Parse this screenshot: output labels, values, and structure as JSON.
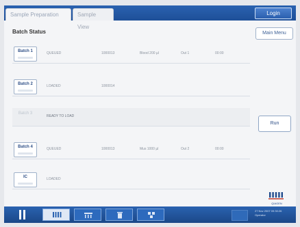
{
  "tabs": [
    {
      "label": "Sample Preparation"
    },
    {
      "label": "Sample View"
    }
  ],
  "login_label": "Login",
  "section_title": "Batch Status",
  "main_menu_label": "Main Menu",
  "batches": [
    {
      "label": "Batch 1",
      "status": "QUEUED",
      "id": "1000013",
      "volume": "Blood 200 µl",
      "output": "Out 1",
      "time": "00:00"
    },
    {
      "label": "Batch 2",
      "status": "LOADED",
      "id": "1000014",
      "volume": "",
      "output": "",
      "time": ""
    },
    {
      "label": "Batch 3",
      "status": "READY TO LOAD",
      "id": "",
      "volume": "",
      "output": "",
      "time": ""
    },
    {
      "label": "Batch 4",
      "status": "QUEUED",
      "id": "1000013",
      "volume": "Mus 1000 µl",
      "output": "Out 2",
      "time": "00:00"
    },
    {
      "label": "IC",
      "status": "LOADED",
      "id": "",
      "volume": "",
      "output": "",
      "time": ""
    }
  ],
  "run_label": "Run",
  "logo_text": "QIAGEN",
  "status_lines": [
    "27 Nov 2007 09:30:26",
    "Operator"
  ],
  "colors": {
    "accent": "#2a62b0",
    "text": "#2d4e86"
  }
}
